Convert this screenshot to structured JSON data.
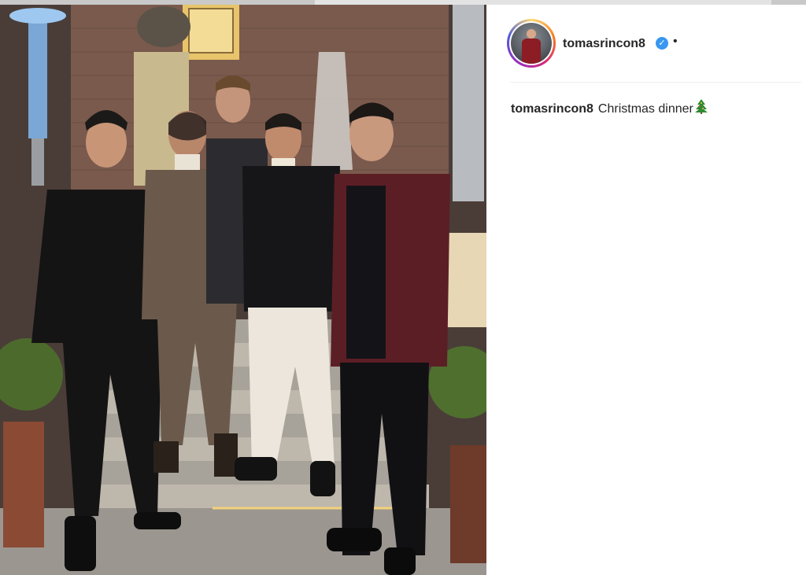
{
  "post": {
    "photo_description_icon": "group-photo",
    "author": {
      "username": "tomasrincon8",
      "verified_icon": "verified-badge-icon",
      "separator": "•",
      "avatar_icon": "profile-picture"
    },
    "caption": {
      "username": "tomasrincon8",
      "text": "Christmas dinner",
      "emoji_icon": "christmas-tree-icon"
    }
  },
  "colors": {
    "verified": "#3897f0",
    "text": "#262626",
    "divider": "#efefef"
  }
}
